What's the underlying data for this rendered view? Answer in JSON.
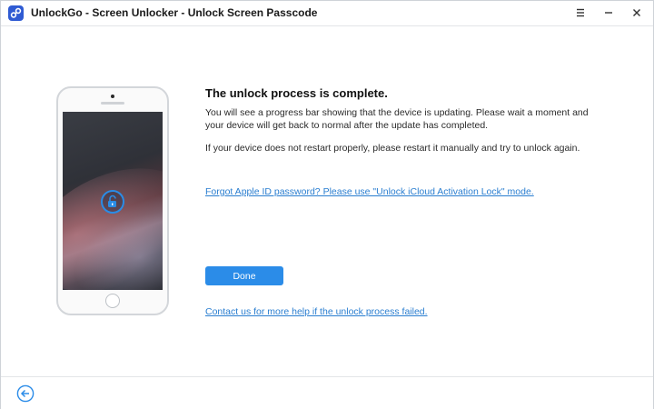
{
  "window": {
    "title": "UnlockGo - Screen Unlocker - Unlock Screen Passcode",
    "logo_icon": "unlockgo-logo-icon",
    "controls": [
      "menu-icon",
      "minimize-icon",
      "close-icon"
    ]
  },
  "main": {
    "heading": "The unlock process is complete.",
    "paragraph1": "You will see a progress bar showing that the device is updating. Please wait a moment and your device will get back to normal after the update has completed.",
    "paragraph2": "If your device does not restart properly, please restart it manually and try to unlock again.",
    "forgot_link": "Forgot Apple ID password? Please use \"Unlock iCloud Activation Lock\" mode.",
    "done_label": "Done",
    "contact_link": "Contact us for more help if the unlock process failed."
  },
  "phone": {
    "screen_icon": "unlocked-padlock-icon"
  },
  "footer": {
    "back_icon": "back-arrow-icon"
  },
  "colors": {
    "accent": "#2b8ce8",
    "link": "#2a7ed0",
    "logo": "#2f5bd3"
  }
}
